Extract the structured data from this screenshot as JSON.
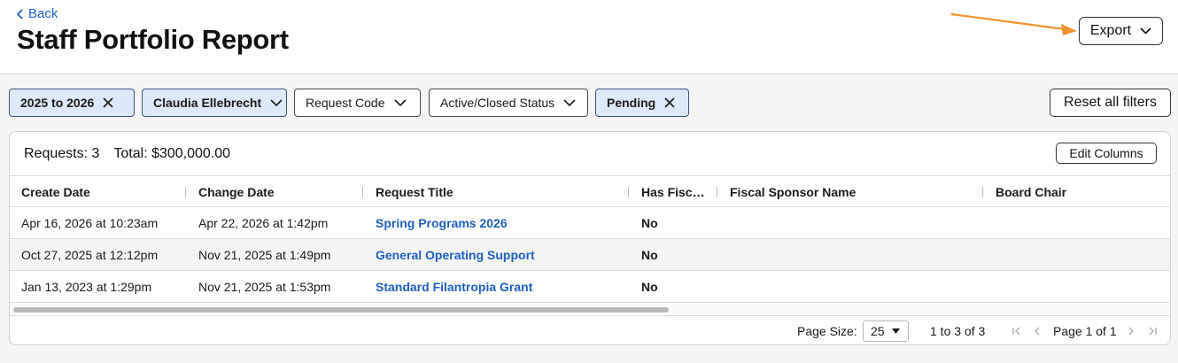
{
  "header": {
    "back_label": "Back",
    "title": "Staff Portfolio Report",
    "export_label": "Export",
    "annotation_arrow_color": "#f0952e"
  },
  "filters": {
    "chips": [
      {
        "label": "2025 to 2026",
        "active": true,
        "icon": "close-icon"
      },
      {
        "label": "Claudia Ellebrecht",
        "active": true,
        "icon": "chevron-down-icon"
      },
      {
        "label": "Request Code",
        "active": false,
        "icon": "chevron-down-icon"
      },
      {
        "label": "Active/Closed Status",
        "active": false,
        "icon": "chevron-down-icon"
      },
      {
        "label": "Pending",
        "active": true,
        "icon": "close-icon"
      }
    ],
    "reset_label": "Reset all filters"
  },
  "summary": {
    "requests": "Requests: 3",
    "total": "Total: $300,000.00",
    "edit_columns_label": "Edit Columns"
  },
  "table": {
    "columns": [
      "Create Date",
      "Change Date",
      "Request Title",
      "Has Fisc…",
      "Fiscal Sponsor Name",
      "Board Chair"
    ],
    "rows": [
      [
        "Apr 16, 2026 at 10:23am",
        "Apr 22, 2026 at 1:42pm",
        "Spring Programs 2026",
        "No",
        "",
        ""
      ],
      [
        "Oct 27, 2025 at 12:12pm",
        "Nov 21, 2025 at 1:49pm",
        "General Operating Support",
        "No",
        "",
        ""
      ],
      [
        "Jan 13, 2023 at 1:29pm",
        "Nov 21, 2025 at 1:53pm",
        "Standard Filantropia Grant",
        "No",
        "",
        ""
      ]
    ]
  },
  "pagination": {
    "page_size_label": "Page Size:",
    "page_size_value": "25",
    "range": "1 to 3 of 3",
    "page_label": "Page 1 of 1"
  },
  "colors": {
    "link": "#1f5fbf",
    "active_chip_bg": "#dde9f7"
  }
}
